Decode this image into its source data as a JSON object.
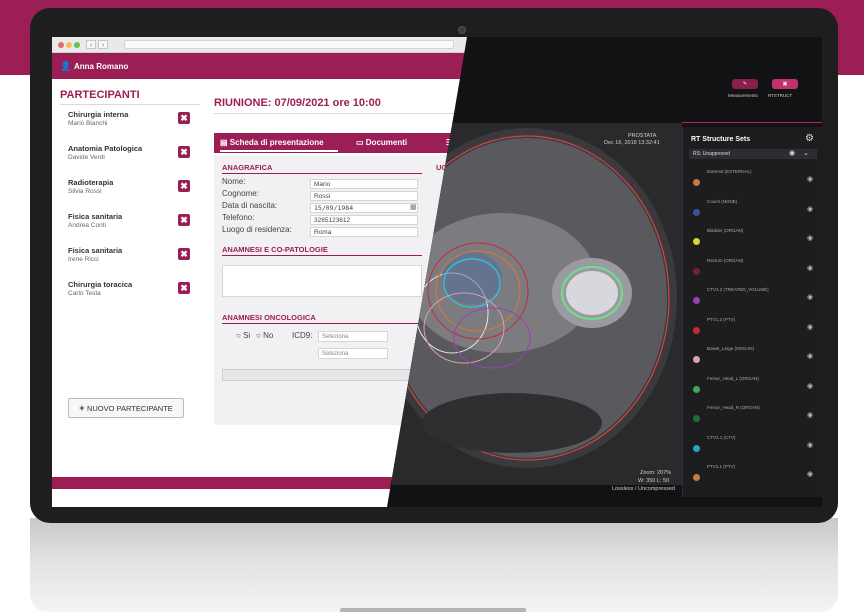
{
  "user": {
    "name": "Anna Romano"
  },
  "participants": {
    "title": "PARTECIPANTI",
    "items": [
      {
        "role": "Chirurgia interna",
        "name": "Mario Bianchi"
      },
      {
        "role": "Anatomia Patologica",
        "name": "Davide Verdi"
      },
      {
        "role": "Radioterapia",
        "name": "Silvia Rossi"
      },
      {
        "role": "Fisica sanitaria",
        "name": "Andrea Conti"
      },
      {
        "role": "Fisica sanitaria",
        "name": "Irene Ricci"
      },
      {
        "role": "Chirurgia toracica",
        "name": "Carlo Testa"
      }
    ],
    "delete_glyph": "✖",
    "add_label": "NUOVO PARTECIPANTE"
  },
  "meeting": {
    "title": "RIUNIONE: 07/09/2021 ore 10:00"
  },
  "tabs": {
    "presentation": "Scheda di presentazione",
    "documents": "Documenti"
  },
  "anagrafica": {
    "title": "ANAGRAFICA",
    "fields": [
      {
        "label": "Nome:",
        "value": "Mario"
      },
      {
        "label": "Cognome:",
        "value": "Rossi"
      },
      {
        "label": "Data di nascita:",
        "value": "15/09/1984"
      },
      {
        "label": "Telefono:",
        "value": "3285123612"
      },
      {
        "label": "Luogo di residenza:",
        "value": "Roma"
      }
    ]
  },
  "anamnesi": {
    "title": "ANAMNESI E CO-PATOLOGIE"
  },
  "oncologica": {
    "title": "ANAMNESI ONCOLOGICA",
    "yes": "Si",
    "no": "No",
    "icd9": "ICD9:",
    "select1": "Seleziona",
    "select2": "Seleziona"
  },
  "viewer": {
    "study": "PROSTATA",
    "date": "Dec 16, 2018 13:32:41",
    "zoom": "Zoom: 207%",
    "window": "W: 350 L: 50",
    "compression": "Lossless / Uncompressed",
    "btn_measurements": "Measurements",
    "btn_rtstruct": "RTSTRUCT"
  },
  "rt": {
    "title": "RT Structure Sets",
    "selected": "RS: Unapproved",
    "structures": [
      {
        "label": "External (EXTERNAL)",
        "color": "#c07d3c"
      },
      {
        "label": "Couch (NONE)",
        "color": "#3652a3"
      },
      {
        "label": "Bladder (ORGAN)",
        "color": "#d6d63a"
      },
      {
        "label": "Rectum (ORGAN)",
        "color": "#7a2030"
      },
      {
        "label": "CTV1.2 (TREATED_VOLUME)",
        "color": "#9b3fb8"
      },
      {
        "label": "PTV1.2 (PTV)",
        "color": "#c42b3a"
      },
      {
        "label": "Bowel_Large (ORGAN)",
        "color": "#d9a3ad"
      },
      {
        "label": "Femur_Head_L (ORGAN)",
        "color": "#3fa85b"
      },
      {
        "label": "Femur_Head_R (ORGAN)",
        "color": "#1f6e36"
      },
      {
        "label": "CTV1.1 (CTV)",
        "color": "#29a5c2"
      },
      {
        "label": "PTV1.1 (PTV)",
        "color": "#c07d3c"
      }
    ]
  }
}
